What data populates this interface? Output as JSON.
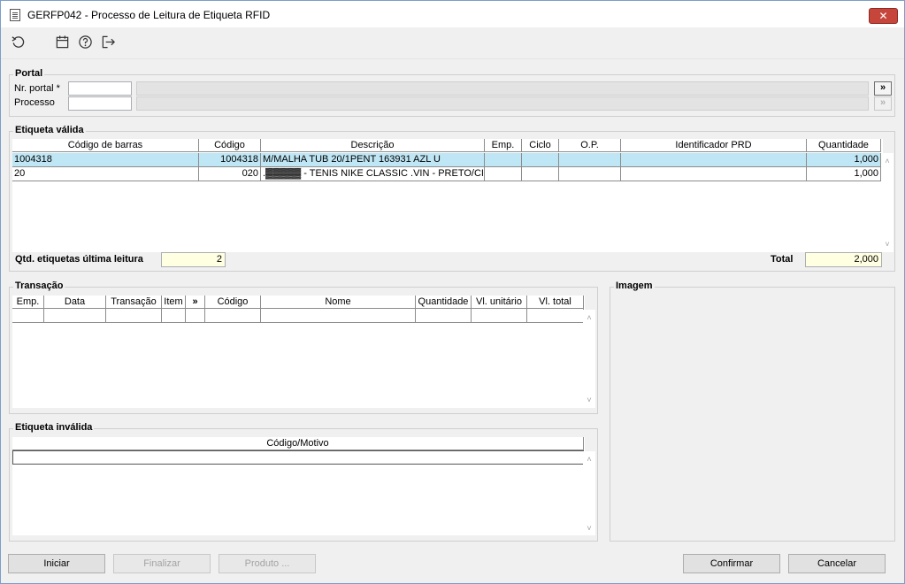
{
  "window": {
    "title": "GERFP042 - Processo de Leitura de Etiqueta RFID",
    "close_label": "✕"
  },
  "toolbar": {
    "icons": [
      "refresh-icon",
      "calendar-icon",
      "help-icon",
      "exit-icon"
    ]
  },
  "portal": {
    "legend": "Portal",
    "nr_portal_label": "Nr. portal *",
    "nr_portal_value": "",
    "processo_label": "Processo",
    "processo_value": "",
    "lookup_btn": "»"
  },
  "valid": {
    "legend": "Etiqueta válida",
    "columns": [
      "Código de barras",
      "Código",
      "Descrição",
      "Emp.",
      "Ciclo",
      "O.P.",
      "Identificador PRD",
      "Quantidade"
    ],
    "rows": [
      [
        "1004318",
        "1004318",
        "M/MALHA TUB 20/1PENT 163931 AZL U",
        "",
        "",
        "",
        "",
        "1,000"
      ],
      [
        "20",
        "020",
        ".▓▓▓▓▓ - TENIS NIKE CLASSIC .VIN - PRETO/CINZ.",
        "",
        "",
        "",
        "",
        "1,000"
      ]
    ],
    "qtd_label": "Qtd. etiquetas última leitura",
    "qtd_value": "2",
    "total_label": "Total",
    "total_value": "2,000"
  },
  "transacao": {
    "legend": "Transação",
    "columns": [
      "Emp.",
      "Data",
      "Transação",
      "Item",
      "»",
      "Código",
      "Nome",
      "Quantidade",
      "Vl. unitário",
      "Vl. total"
    ]
  },
  "imagem": {
    "legend": "Imagem"
  },
  "invalid": {
    "legend": "Etiqueta inválida",
    "columns": [
      "Código/Motivo"
    ]
  },
  "buttons": {
    "iniciar": "Iniciar",
    "finalizar": "Finalizar",
    "produto": "Produto ...",
    "confirmar": "Confirmar",
    "cancelar": "Cancelar"
  },
  "scroll": {
    "up": "˄",
    "down": "˅"
  }
}
